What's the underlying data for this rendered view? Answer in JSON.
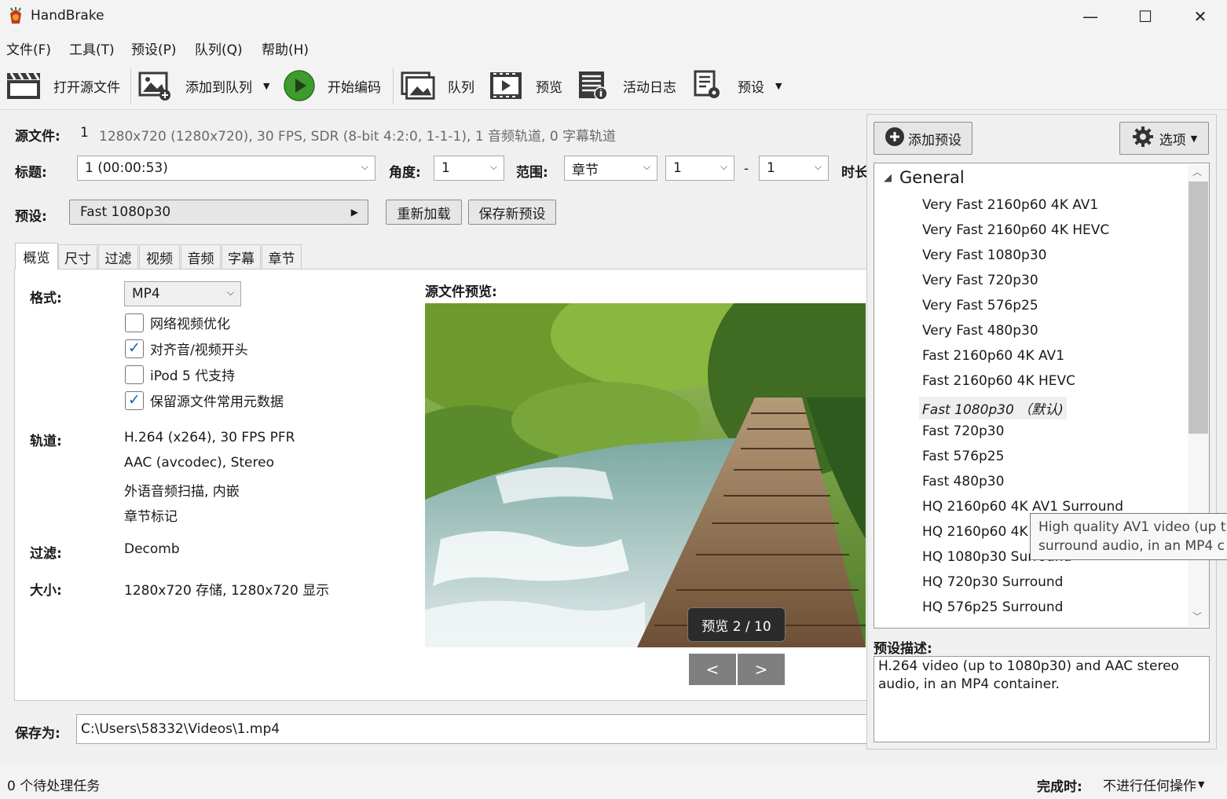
{
  "window": {
    "title": "HandBrake",
    "minimize": "—",
    "maximize": "☐",
    "close": "✕"
  },
  "menu": [
    "文件(F)",
    "工具(T)",
    "预设(P)",
    "队列(Q)",
    "帮助(H)"
  ],
  "toolbar": {
    "open_source": "打开源文件",
    "add_to_queue": "添加到队列",
    "start_encode": "开始编码",
    "queue": "队列",
    "preview": "预览",
    "activity_log": "活动日志",
    "presets": "预设"
  },
  "source": {
    "label": "源文件:",
    "index": "1",
    "info": "1280x720 (1280x720), 30 FPS, SDR (8-bit 4:2:0, 1-1-1), 1 音频轨道, 0 字幕轨道"
  },
  "title_row": {
    "title_label": "标题:",
    "title_value": "1  (00:00:53)",
    "angle_label": "角度:",
    "angle_value": "1",
    "range_label": "范围:",
    "range_type": "章节",
    "range_start": "1",
    "range_dash": "-",
    "range_end": "1",
    "duration_label": "时长"
  },
  "preset_row": {
    "label": "预设:",
    "value": "Fast 1080p30",
    "reload": "重新加载",
    "save_new": "保存新预设"
  },
  "tabs": [
    "概览",
    "尺寸",
    "过滤",
    "视频",
    "音频",
    "字幕",
    "章节"
  ],
  "summary": {
    "format_label": "格式:",
    "format_value": "MP4",
    "options": [
      {
        "label": "网络视频优化",
        "checked": false
      },
      {
        "label": "对齐音/视频开头",
        "checked": true
      },
      {
        "label": "iPod 5 代支持",
        "checked": false
      },
      {
        "label": "保留源文件常用元数据",
        "checked": true
      }
    ],
    "tracks_label": "轨道:",
    "tracks": [
      "H.264 (x264), 30 FPS PFR",
      "AAC (avcodec), Stereo",
      "外语音频扫描, 内嵌",
      "章节标记"
    ],
    "filters_label": "过滤:",
    "filters_value": "Decomb",
    "size_label": "大小:",
    "size_value": "1280x720 存储, 1280x720 显示"
  },
  "preview": {
    "title": "源文件预览:",
    "counter": "预览 2 / 10",
    "prev": "<",
    "next": ">"
  },
  "save": {
    "label": "保存为:",
    "path": "C:\\Users\\58332\\Videos\\1.mp4"
  },
  "status": {
    "pending": "0 个待处理任务",
    "when_done_label": "完成时:",
    "when_done_value": "不进行任何操作"
  },
  "presets_panel": {
    "add_preset": "添加预设",
    "options": "选项",
    "group": "General",
    "items": [
      "Very Fast 2160p60 4K AV1",
      "Very Fast 2160p60 4K HEVC",
      "Very Fast 1080p30",
      "Very Fast 720p30",
      "Very Fast 576p25",
      "Very Fast 480p30",
      "Fast 2160p60 4K AV1",
      "Fast 2160p60 4K HEVC",
      "Fast 1080p30  （默认)",
      "Fast 720p30",
      "Fast 576p25",
      "Fast 480p30",
      "HQ 2160p60 4K AV1 Surround",
      "HQ 2160p60 4K HEVC Surround",
      "HQ 1080p30 Surround",
      "HQ 720p30 Surround",
      "HQ 576p25 Surround"
    ],
    "selected_index": 8,
    "description_label": "预设描述:",
    "description": "H.264 video (up to 1080p30) and AAC stereo audio, in an MP4 container.",
    "tooltip_line1": "High quality AV1 video (up t",
    "tooltip_line2": "surround audio, in an MP4 c"
  }
}
